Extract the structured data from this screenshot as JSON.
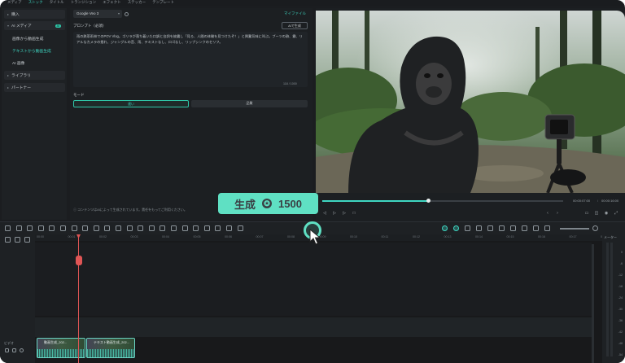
{
  "menubar": [
    "メディア",
    "ストック",
    "タイトル",
    "トランジション",
    "エフェクト",
    "ステッカー",
    "テンプレート"
  ],
  "sidebar": {
    "items": [
      {
        "label": "購入",
        "kind": "group"
      },
      {
        "label": "AI メディア",
        "kind": "group",
        "badge": "AI"
      },
      {
        "label": "画像から動画生成",
        "kind": "item"
      },
      {
        "label": "テキストから動画生成",
        "kind": "item-active"
      },
      {
        "label": "AI 画像",
        "kind": "item"
      },
      {
        "label": "ライブラリ",
        "kind": "group"
      },
      {
        "label": "パートナー",
        "kind": "group"
      }
    ]
  },
  "panel": {
    "model": "Google Veo 3",
    "my_files": "マイファイル",
    "prompt_label": "プロンプト（必須）",
    "ai_generate_button": "AIで生成",
    "prompt_text": "雨の熱帯雨林でのPOV Vlog。ゴリラが落ち着いた口調と台詞を披露し「見ろ、人間の体験を見つけたぞ！」と興奮気味に叫ぶ。ブーツの跡、霧、リアルなカメラの揺れ、ジャングルの音、雨、テキストなし、ロゴなし、リップシンクのセリフ。",
    "char_count": "118 / 1000",
    "mode_label": "モード",
    "mode_options": [
      "速い",
      "品質"
    ],
    "footnote": "コンテンツはAIによって生成されています。責任をもってご利用ください。"
  },
  "preview": {
    "current_time": "00:00:07:00",
    "total_time": "00:00:16:00",
    "progress": 0.44
  },
  "gen_badge": {
    "label": "生成",
    "coin_glyph": "✪",
    "cost": "1500"
  },
  "timeline": {
    "ruler_labels": [
      "00:00",
      "00:01",
      "00:02",
      "00:03",
      "00:04",
      "00:05",
      "00:06",
      "00:07",
      "00:08",
      "00:09",
      "00:10",
      "00:11",
      "00:12",
      "00:13",
      "00:14",
      "00:15",
      "00:16",
      "00:17",
      "00:18"
    ],
    "track_label": "ビデオ",
    "clips": [
      {
        "title": "動画生成_202..."
      },
      {
        "title": "テキスト動画生成_202..."
      }
    ]
  },
  "meter": {
    "label": "メーター",
    "scale": [
      "0",
      "-6",
      "-12",
      "-18",
      "-24",
      "-30",
      "-36",
      "-42",
      "-48",
      "-54"
    ]
  },
  "colors": {
    "accent": "#3ed6c2",
    "badge": "#5fe0c3",
    "playhead": "#e05555"
  }
}
